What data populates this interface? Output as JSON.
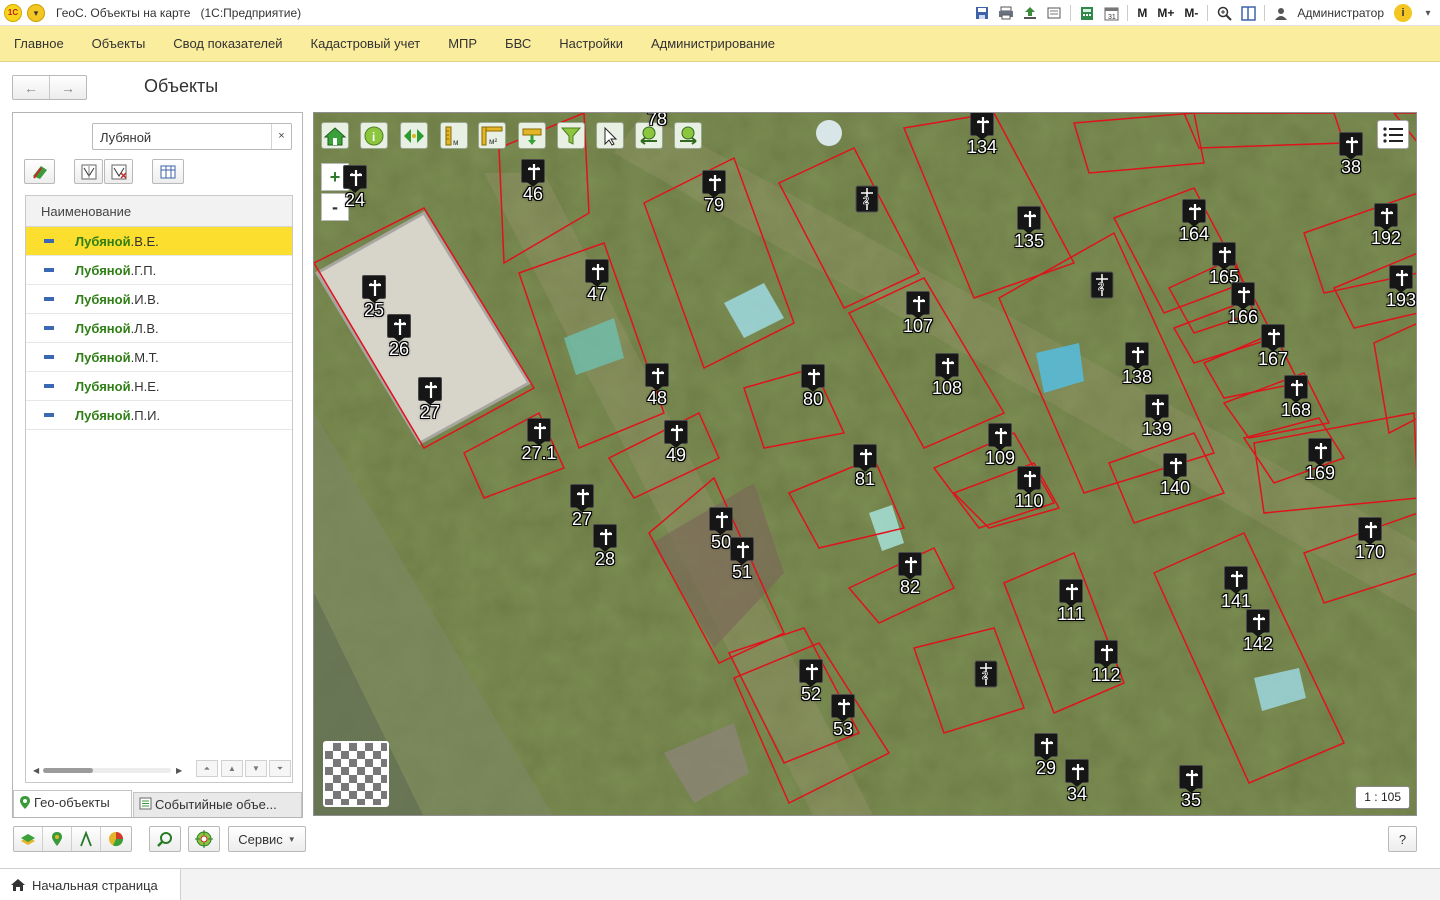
{
  "window": {
    "title": "ГеоС. Объекты на карте",
    "platform": "(1С:Предприятие)",
    "user": "Администратор",
    "memory_buttons": [
      "M",
      "M+",
      "M-"
    ]
  },
  "sections": [
    "Главное",
    "Объекты",
    "Свод показателей",
    "Кадастровый учет",
    "МПР",
    "БВС",
    "Настройки",
    "Администрирование"
  ],
  "form": {
    "title": "Объекты",
    "search_value": "Лубяной",
    "search_clear": "×",
    "grid_header": "Наименование",
    "rows": [
      {
        "bold": "Лубяной",
        "rest": ".В.Е.",
        "selected": true
      },
      {
        "bold": "Лубяной",
        "rest": ".Г.П.",
        "selected": false
      },
      {
        "bold": "Лубяной",
        "rest": ".И.В.",
        "selected": false
      },
      {
        "bold": "Лубяной",
        "rest": ".Л.В.",
        "selected": false
      },
      {
        "bold": "Лубяной",
        "rest": ".М.Т.",
        "selected": false
      },
      {
        "bold": "Лубяной",
        "rest": ".Н.Е.",
        "selected": false
      },
      {
        "bold": "Лубяной",
        "rest": ".П.И.",
        "selected": false
      }
    ],
    "tabs": [
      "Гео-объекты",
      "Событийные объе..."
    ]
  },
  "map": {
    "scale": "1 : 105",
    "zoom_in": "+",
    "zoom_out": "-",
    "markers": [
      "24",
      "46",
      "78",
      "79",
      "134",
      "38",
      "135",
      "164",
      "192",
      "193",
      "165",
      "166",
      "167",
      "168",
      "169",
      "170",
      "25",
      "26",
      "27",
      "47",
      "48",
      "49",
      "27.1",
      "27",
      "28",
      "50",
      "51",
      "52",
      "53",
      "80",
      "81",
      "82",
      "107",
      "108",
      "109",
      "110",
      "111",
      "112",
      "138",
      "139",
      "140",
      "141",
      "142",
      "29",
      "34",
      "35"
    ],
    "double_markers": [
      "2",
      "2",
      "2"
    ]
  },
  "bottom": {
    "service_label": "Сервис",
    "help_label": "?"
  },
  "homebar": {
    "label": "Начальная страница"
  },
  "colors": {
    "section_bar": "#fbed9e",
    "selected_row": "#fbde2e",
    "plot_border": "#e0121b",
    "name_highlight": "#2f7f16"
  }
}
